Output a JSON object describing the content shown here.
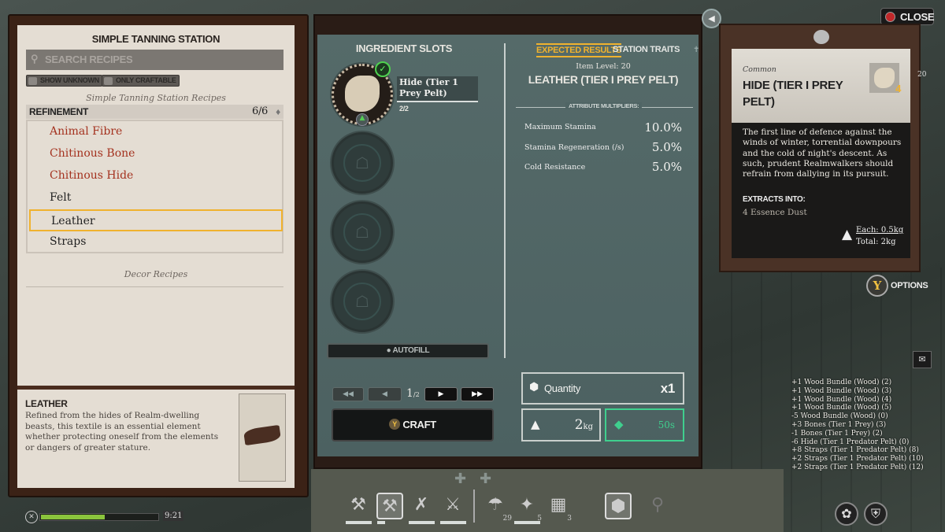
{
  "recipes_panel": {
    "title": "SIMPLE TANNING STATION",
    "search_placeholder": "SEARCH RECIPES",
    "toggles": [
      "SHOW UNKNOWN",
      "ONLY CRAFTABLE"
    ],
    "section_label": "Simple Tanning Station Recipes",
    "category": "REFINEMENT",
    "category_count": "6/6",
    "items": [
      {
        "label": "Animal Fibre",
        "state": "unavailable"
      },
      {
        "label": "Chitinous Bone",
        "state": "unavailable"
      },
      {
        "label": "Chitinous Hide",
        "state": "unavailable"
      },
      {
        "label": "Felt",
        "state": "available"
      },
      {
        "label": "Leather",
        "state": "selected"
      },
      {
        "label": "Straps",
        "state": "available"
      }
    ],
    "decor_label": "Decor Recipes",
    "detail": {
      "title": "LEATHER",
      "description": "Refined from the hides of Realm-dwelling beasts, this textile is an essential element whether protecting oneself from the elements or dangers of greater stature."
    }
  },
  "ingredients": {
    "title": "INGREDIENT SLOTS",
    "slot1": {
      "name": "Hide (Tier 1 Prey Pelt)",
      "count": "2/2"
    },
    "autofill": "AUTOFILL",
    "page_current": "1",
    "page_total": "2",
    "craft": "CRAFT",
    "craft_key": "Y"
  },
  "results": {
    "tabs": [
      "EXPECTED RESULTS",
      "STATION TRAITS"
    ],
    "active_tab": 0,
    "item_level": "Item Level: 20",
    "item_name": "LEATHER (TIER I PREY PELT)",
    "multipliers_label": "ATTRIBUTE MULTIPLIERS:",
    "attributes": [
      {
        "name": "Maximum Stamina",
        "value": "10.0%"
      },
      {
        "name": "Stamina Regeneration (/s)",
        "value": "5.0%"
      },
      {
        "name": "Cold Resistance",
        "value": "5.0%"
      }
    ],
    "quantity_label": "Quantity",
    "quantity": "x1",
    "weight": "2",
    "weight_unit": "kg",
    "time": "50s"
  },
  "tooltip": {
    "rarity": "Common",
    "title": "HIDE (TIER I PREY PELT)",
    "icon_count": "4",
    "side_level": "20",
    "description": "The first line of defence against the winds of winter, torrential downpours and the cold of night's descent. As such, prudent Realmwalkers should refrain from dallying in its pursuit.",
    "extracts_label": "EXTRACTS INTO:",
    "extracts": "4 Essence Dust",
    "each": "Each: 0.5kg",
    "total": "Total: 2kg"
  },
  "top": {
    "close": "CLOSE",
    "options_key": "Y",
    "options": "OPTIONS"
  },
  "log": [
    "+1 Wood Bundle (Wood) (2)",
    "+1 Wood Bundle (Wood) (3)",
    "+1 Wood Bundle (Wood) (4)",
    "+1 Wood Bundle (Wood) (5)",
    "-5 Wood Bundle (Wood) (0)",
    "+3 Bones (Tier 1 Prey) (3)",
    "-1 Bones (Tier 1 Prey) (2)",
    "-6 Hide (Tier 1 Predator Pelt) (0)",
    "+8 Straps (Tier 1 Predator Pelt) (8)",
    "+2 Straps (Tier 1 Predator Pelt) (10)",
    "+2 Straps (Tier 1 Predator Pelt) (12)"
  ],
  "status": {
    "time": "9:21",
    "stamina_fraction": 0.55
  },
  "hotbar": {
    "counts": [
      "29",
      "5",
      "3"
    ]
  },
  "colors": {
    "accent": "#f0b22e",
    "unavailable": "#a4321f",
    "time_green": "#3fcf8e"
  }
}
